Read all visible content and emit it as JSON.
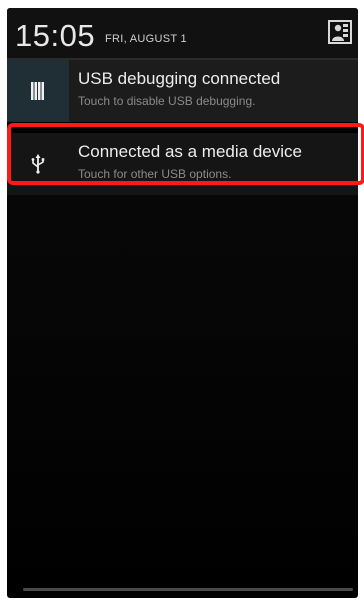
{
  "status": {
    "time": "15:05",
    "date": "FRI, AUGUST 1"
  },
  "header": {
    "settings_icon": "quick-settings-icon"
  },
  "notifications": [
    {
      "icon": "usb-debugging-icon",
      "title": "USB debugging connected",
      "subtitle": "Touch to disable USB debugging."
    },
    {
      "icon": "usb-icon",
      "title": "Connected as a media device",
      "subtitle": "Touch for other USB options."
    }
  ],
  "colors": {
    "highlight": "#ff1a1a",
    "background": "#000000",
    "notification": "#1c1c1c"
  }
}
